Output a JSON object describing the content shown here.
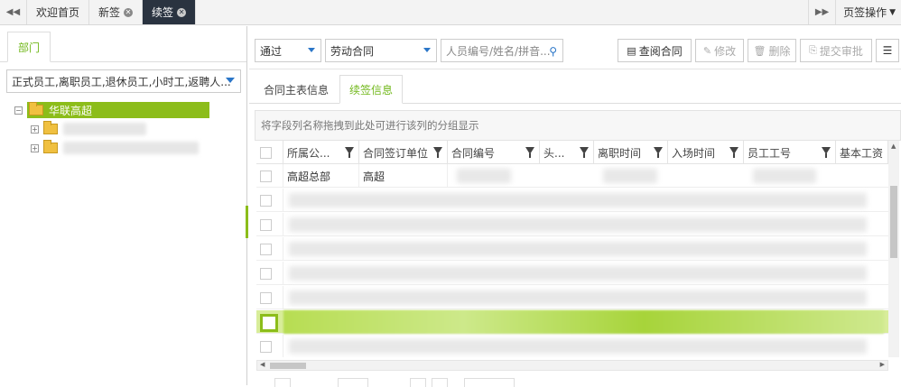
{
  "topbar": {
    "tabs": [
      {
        "label": "欢迎首页",
        "closable": false,
        "active": false
      },
      {
        "label": "新签",
        "closable": true,
        "active": false
      },
      {
        "label": "续签",
        "closable": true,
        "active": true
      }
    ],
    "page_ops_label": "页签操作"
  },
  "left": {
    "dept_tab": "部门",
    "employee_type_value": "正式员工,离职员工,退休员工,小时工,返聘人...",
    "tree": {
      "root": "华联高超"
    }
  },
  "toolbar": {
    "status_value": "通过",
    "contract_type_value": "劳动合同",
    "search_placeholder": "人员编号/姓名/拼音...",
    "btn_view": "查阅合同",
    "btn_edit": "修改",
    "btn_delete": "删除",
    "btn_submit": "提交审批"
  },
  "subtabs": {
    "main_info": "合同主表信息",
    "renew_info": "续签信息"
  },
  "grid": {
    "group_hint": "将字段列名称拖拽到此处可进行该列的分组显示",
    "columns": [
      "所属公...",
      "合同签订单位",
      "合同编号",
      "头...",
      "离职时间",
      "入场时间",
      "员工工号",
      "基本工资"
    ],
    "first_row": {
      "company": "高超总部",
      "unit": "高超"
    }
  },
  "colors": {
    "accent_green": "#8cbd1a",
    "active_tab_bg": "#2a3340",
    "link_blue": "#2b76c8"
  }
}
